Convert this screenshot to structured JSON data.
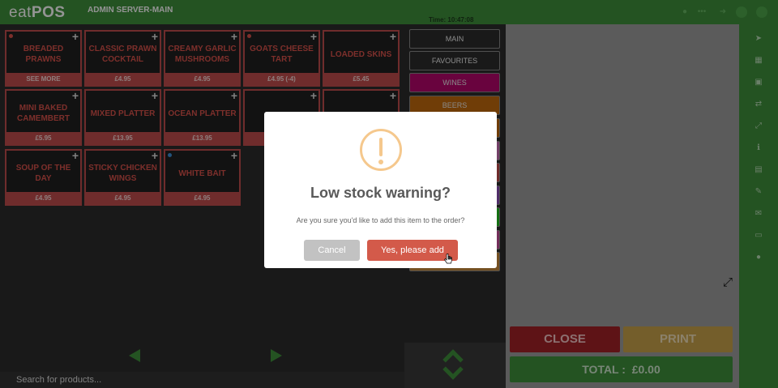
{
  "header": {
    "logo_light": "eat",
    "logo_bold": "POS",
    "server": "ADMIN SERVER-MAIN",
    "time": "Time: 10:47:08"
  },
  "colors": {
    "brand_green": "#3f8f3c",
    "tile_red": "#c04c4c",
    "wines": "#b5066b",
    "beers": "#c1690d",
    "close": "#a22127",
    "print": "#c9a24a",
    "warning": "#f5c88d"
  },
  "products": [
    {
      "name": "BREADED PRAWNS",
      "price": "SEE MORE",
      "dot": "#d8524b"
    },
    {
      "name": "CLASSIC PRAWN COCKTAIL",
      "price": "£4.95",
      "dot": ""
    },
    {
      "name": "CREAMY GARLIC MUSHROOMS",
      "price": "£4.95",
      "dot": ""
    },
    {
      "name": "GOATS CHEESE TART",
      "price": "£4.95 (-4)",
      "dot": "#d8524b"
    },
    {
      "name": "LOADED SKINS",
      "price": "£5.45",
      "dot": ""
    },
    {
      "name": "MINI BAKED CAMEMBERT",
      "price": "£5.95",
      "dot": ""
    },
    {
      "name": "MIXED PLATTER",
      "price": "£13.95",
      "dot": ""
    },
    {
      "name": "OCEAN PLATTER",
      "price": "£13.95",
      "dot": ""
    },
    {
      "name": "",
      "price": "",
      "dot": ""
    },
    {
      "name": "",
      "price": "",
      "dot": ""
    },
    {
      "name": "SOUP OF THE DAY",
      "price": "£4.95",
      "dot": ""
    },
    {
      "name": "STICKY CHICKEN WINGS",
      "price": "£4.95",
      "dot": ""
    },
    {
      "name": "WHITE BAIT",
      "price": "£4.95",
      "dot": "#3d8fd6"
    }
  ],
  "categories": [
    {
      "label": "MAIN",
      "bg": "#2b2b2b"
    },
    {
      "label": "FAVOURITES",
      "bg": "#2b2b2b"
    },
    {
      "label": "WINES",
      "bg": "#b5066b"
    },
    {
      "label": "BEERS",
      "bg": "#c1690d"
    }
  ],
  "search": {
    "placeholder": "Search for products..."
  },
  "order": {
    "close_label": "CLOSE",
    "print_label": "PRINT",
    "total_label": "TOTAL :",
    "total_value": "£0.00"
  },
  "toolbar": {
    "icons": [
      "location-arrow-icon",
      "table-icon",
      "cash-icon",
      "transfer-icon",
      "resize-icon",
      "info-icon",
      "note-icon",
      "edit-icon",
      "mail-icon",
      "card-icon",
      "circle-icon"
    ]
  },
  "modal": {
    "title": "Low stock warning?",
    "text": "Are you sure you'd like to add this item to the order?",
    "cancel_label": "Cancel",
    "confirm_label": "Yes, please add"
  }
}
